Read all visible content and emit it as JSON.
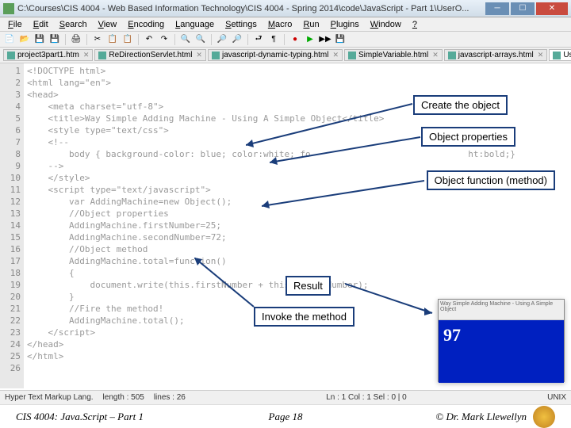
{
  "window": {
    "title": "C:\\Courses\\CIS 4004 - Web Based Information Technology\\CIS 4004 - Spring 2014\\code\\JavaScript - Part 1\\UserO..."
  },
  "menu": [
    "File",
    "Edit",
    "Search",
    "View",
    "Encoding",
    "Language",
    "Settings",
    "Macro",
    "Run",
    "Plugins",
    "Window",
    "?"
  ],
  "tabs": [
    {
      "label": "project3part1.htm"
    },
    {
      "label": "ReDirectionServlet.html"
    },
    {
      "label": "javascript-dynamic-typing.html"
    },
    {
      "label": "SimpleVariable.html"
    },
    {
      "label": "javascript-arrays.html"
    },
    {
      "label": "UserObject.html",
      "active": true
    }
  ],
  "code_lines": [
    "<!DOCTYPE html>",
    "<html lang=\"en\">",
    "<head>",
    "    <meta charset=\"utf-8\">",
    "    <title>Way Simple Adding Machine - Using A Simple Object</title>",
    "    <style type=\"text/css\">",
    "    <!--",
    "        body { background-color: blue; color:white; fo                              ht:bold;}",
    "    -->",
    "    </style>",
    "    <script type=\"text/javascript\">",
    "        var AddingMachine=new Object();",
    "        //Object properties",
    "        AddingMachine.firstNumber=25;",
    "        AddingMachine.secondNumber=72;",
    "        //Object method",
    "        AddingMachine.total=function()",
    "        {",
    "            document.write(this.firstNumber + this.secondNumber);",
    "        }",
    "        //Fire the method!",
    "        AddingMachine.total();",
    "    </script>",
    "</head>",
    "</html>",
    ""
  ],
  "callouts": {
    "create": "Create the object",
    "props": "Object properties",
    "method": "Object function (method)",
    "result": "Result",
    "invoke": "Invoke the method"
  },
  "preview": {
    "title": "Way Simple Adding Machine - Using A Simple Object",
    "value": "97"
  },
  "status": {
    "lang": "Hyper Text Markup Lang.",
    "length": "length : 505",
    "lines": "lines : 26",
    "pos": "Ln : 1   Col : 1   Sel : 0 | 0",
    "enc": "UNIX"
  },
  "footer": {
    "left": "CIS 4004: Java.Script – Part 1",
    "center": "Page 18",
    "right": "© Dr. Mark Llewellyn"
  }
}
